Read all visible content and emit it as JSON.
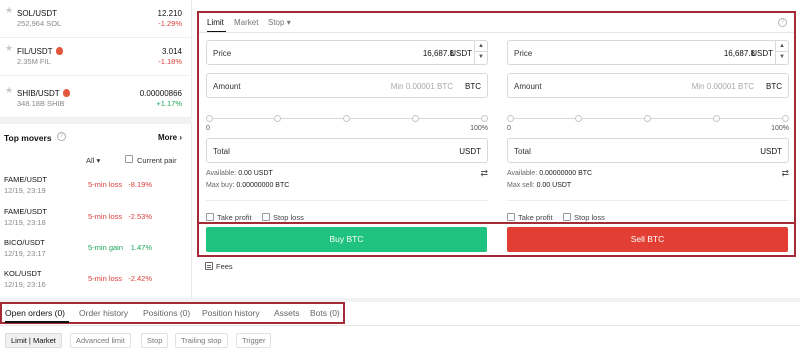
{
  "markets": [
    {
      "pair": "SOL/USDT",
      "volume": "252,964 SOL",
      "price": "12.210",
      "change": "-1.29%",
      "hot": false
    },
    {
      "pair": "FIL/USDT",
      "volume": "2.35M FIL",
      "price": "3.014",
      "change": "-1.18%",
      "hot": true
    },
    {
      "pair": "SHIB/USDT",
      "volume": "348.18B SHIB",
      "price": "0.00000866",
      "change": "+1.17%",
      "hot": true
    }
  ],
  "movers": {
    "title": "Top movers",
    "more": "More",
    "filter_all": "All",
    "filter_current": "Current pair",
    "items": [
      {
        "pair": "FAME/USDT",
        "time": "12/19, 23:19",
        "type": "5-min loss",
        "change": "-8.19%"
      },
      {
        "pair": "FAME/USDT",
        "time": "12/19, 23:18",
        "type": "5-min loss",
        "change": "-2.53%"
      },
      {
        "pair": "BICO/USDT",
        "time": "12/19, 23:17",
        "type": "5-min gain",
        "change": "1.47%"
      },
      {
        "pair": "KOL/USDT",
        "time": "12/19, 23:16",
        "type": "5-min loss",
        "change": "-2.42%"
      }
    ]
  },
  "order_tabs": {
    "limit": "Limit",
    "market": "Market",
    "stop": "Stop"
  },
  "buy_form": {
    "price_label": "Price",
    "price_value": "16,687.8",
    "price_unit": "USDT",
    "amount_label": "Amount",
    "amount_placeholder": "Min 0.00001 BTC",
    "amount_unit": "BTC",
    "slider_min": "0",
    "slider_max": "100%",
    "total_label": "Total",
    "total_unit": "USDT",
    "available_label": "Available:",
    "available_value": "0.00 USDT",
    "max_label": "Max buy:",
    "max_value": "0.00000000 BTC",
    "take_profit": "Take profit",
    "stop_loss": "Stop loss"
  },
  "sell_form": {
    "price_label": "Price",
    "price_value": "16,687.8",
    "price_unit": "USDT",
    "amount_label": "Amount",
    "amount_placeholder": "Min 0.00001 BTC",
    "amount_unit": "BTC",
    "slider_min": "0",
    "slider_max": "100%",
    "total_label": "Total",
    "total_unit": "USDT",
    "available_label": "Available:",
    "available_value": "0.00000000 BTC",
    "max_label": "Max sell:",
    "max_value": "0.00 USDT",
    "take_profit": "Take profit",
    "stop_loss": "Stop loss"
  },
  "buttons": {
    "buy": "Buy BTC",
    "sell": "Sell BTC"
  },
  "fees": "Fees",
  "bottom_tabs": {
    "open": "Open orders (0)",
    "history": "Order history",
    "positions": "Positions (0)",
    "position_history": "Position history",
    "assets": "Assets",
    "bots": "Bots (0)"
  },
  "order_types": {
    "limit_market": "Limit | Market",
    "advanced": "Advanced limit",
    "stop": "Stop",
    "trailing": "Trailing stop",
    "trigger": "Trigger"
  },
  "colors": {
    "buy": "#1fc27e",
    "sell": "#e23e34",
    "negative": "#d9403a",
    "positive": "#1fa55a",
    "highlight": "#a52a36"
  }
}
